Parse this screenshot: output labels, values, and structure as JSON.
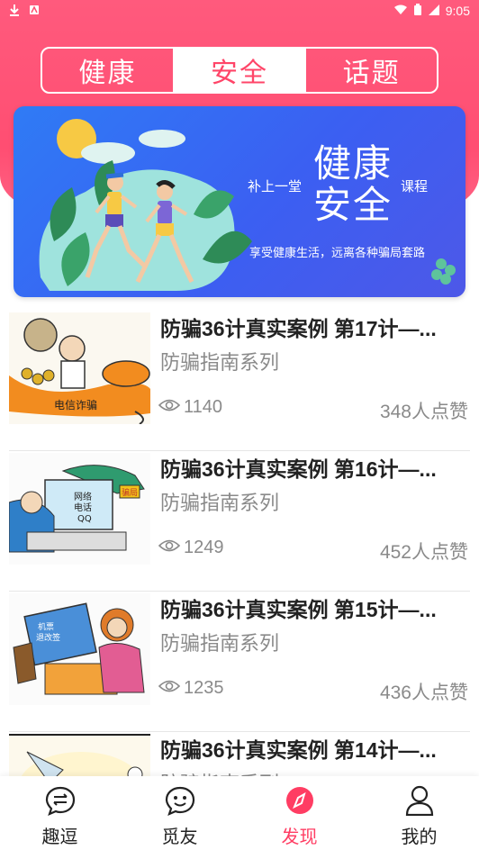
{
  "status": {
    "time": "9:05"
  },
  "tabs": [
    {
      "label": "健康",
      "active": false
    },
    {
      "label": "安全",
      "active": true
    },
    {
      "label": "话题",
      "active": false
    }
  ],
  "banner": {
    "left_text": "补上一堂",
    "title_line1": "健康",
    "title_line2": "安全",
    "right_text": "课程",
    "subtitle": "享受健康生活，远离各种骗局套路"
  },
  "articles": [
    {
      "title": "防骗36计真实案例 第17计—...",
      "series": "防骗指南系列",
      "views": "1140",
      "likes": "348人点赞"
    },
    {
      "title": "防骗36计真实案例 第16计—...",
      "series": "防骗指南系列",
      "views": "1249",
      "likes": "452人点赞"
    },
    {
      "title": "防骗36计真实案例 第15计—...",
      "series": "防骗指南系列",
      "views": "1235",
      "likes": "436人点赞"
    },
    {
      "title": "防骗36计真实案例 第14计—...",
      "series": "防骗指南系列",
      "views": "",
      "likes": ""
    }
  ],
  "thumb_text": {
    "a1": "电信诈骗",
    "a2_line1": "网络",
    "a2_line2": "电话",
    "a2_line3": "QQ",
    "a2_badge": "骗局",
    "a3_line1": "机票",
    "a3_line2": "退改签"
  },
  "tabbar": [
    {
      "label": "趣逗",
      "icon": "chat-heart-icon",
      "active": false
    },
    {
      "label": "觅友",
      "icon": "smile-bubble-icon",
      "active": false
    },
    {
      "label": "发现",
      "icon": "compass-icon",
      "active": true
    },
    {
      "label": "我的",
      "icon": "user-icon",
      "active": false
    }
  ],
  "colors": {
    "accent": "#ff4568",
    "banner_blue": "#3b5ff2",
    "muted": "#8a8a8a"
  }
}
